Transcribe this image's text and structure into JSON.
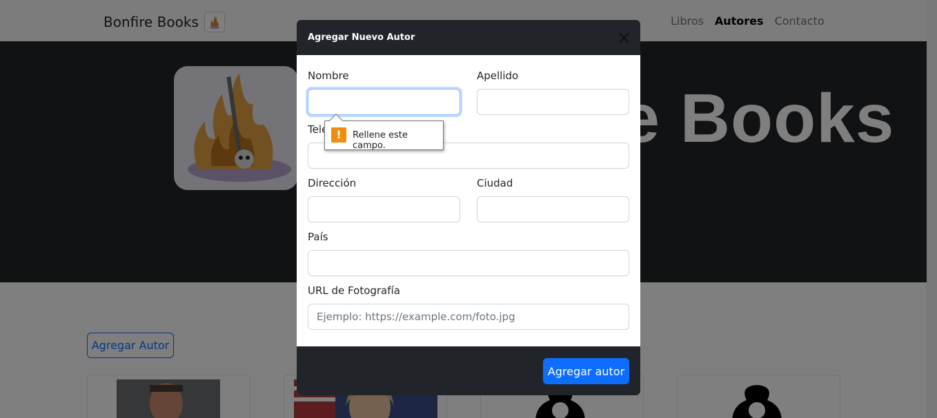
{
  "navbar": {
    "brand": "Bonfire Books",
    "links": [
      {
        "label": "Libros",
        "active": false
      },
      {
        "label": "Autores",
        "active": true
      },
      {
        "label": "Contacto",
        "active": false
      }
    ]
  },
  "hero": {
    "title": "Bonfire Books"
  },
  "page": {
    "add_author_button": "Agregar Autor"
  },
  "modal": {
    "title": "Agregar Nuevo Autor",
    "fields": {
      "nombre": {
        "label": "Nombre",
        "value": ""
      },
      "apellido": {
        "label": "Apellido",
        "value": ""
      },
      "telefono": {
        "label": "Teléfono",
        "value": ""
      },
      "direccion": {
        "label": "Dirección",
        "value": ""
      },
      "ciudad": {
        "label": "Ciudad",
        "value": ""
      },
      "pais": {
        "label": "País",
        "value": ""
      },
      "foto": {
        "label": "URL de Fotografía",
        "value": "",
        "placeholder": "Ejemplo: https://example.com/foto.jpg"
      }
    },
    "submit_label": "Agregar autor",
    "validation_message": "Rellene este campo."
  },
  "colors": {
    "primary": "#0d6efd",
    "dark": "#212529",
    "warning": "#f28c0f"
  }
}
